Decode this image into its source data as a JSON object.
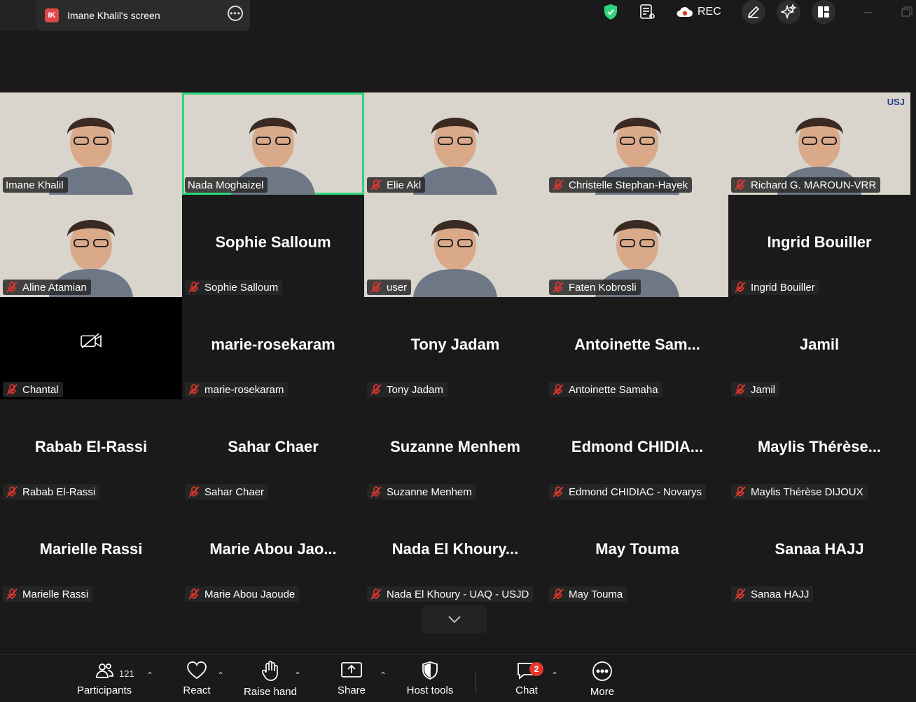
{
  "window": {
    "screen_tab_badge": "IK",
    "screen_tab_title": "Imane Khalil's screen",
    "rec_label": "REC"
  },
  "tiles": [
    {
      "name": "Imane Khalil",
      "video": true,
      "muted": false
    },
    {
      "name": "Nada Moghaizel",
      "video": true,
      "muted": false,
      "active_speaker": true
    },
    {
      "name": "Elie Akl",
      "video": true,
      "muted": true
    },
    {
      "name": "Christelle Stephan-Hayek",
      "video": true,
      "muted": true
    },
    {
      "name": "Richard G. MAROUN-VRR",
      "video": true,
      "muted": true,
      "logo_text": "USJ"
    },
    {
      "name": "Aline Atamian",
      "video": true,
      "muted": true
    },
    {
      "name": "Sophie Salloum",
      "display": "Sophie Salloum",
      "video": false,
      "muted": true
    },
    {
      "name": "user",
      "video": true,
      "muted": true
    },
    {
      "name": "Faten Kobrosli",
      "video": true,
      "muted": true
    },
    {
      "name": "Ingrid Bouiller",
      "display": "Ingrid Bouiller",
      "video": false,
      "muted": true
    },
    {
      "name": "Chantal",
      "video": false,
      "camera_off_icon": true,
      "muted": true
    },
    {
      "name": "marie-rosekaram",
      "display": "marie-rosekaram",
      "video": false,
      "muted": true
    },
    {
      "name": "Tony Jadam",
      "display": "Tony Jadam",
      "video": false,
      "muted": true
    },
    {
      "name": "Antoinette Samaha",
      "display": "Antoinette  Sam...",
      "video": false,
      "muted": true
    },
    {
      "name": "Jamil",
      "display": "Jamil",
      "video": false,
      "muted": true
    },
    {
      "name": "Rabab El-Rassi",
      "display": "Rabab El-Rassi",
      "video": false,
      "muted": true
    },
    {
      "name": "Sahar Chaer",
      "display": "Sahar Chaer",
      "video": false,
      "muted": true
    },
    {
      "name": "Suzanne Menhem",
      "display": "Suzanne Menhem",
      "video": false,
      "muted": true
    },
    {
      "name": "Edmond CHIDIAC - Novarys",
      "display": "Edmond  CHIDIA...",
      "video": false,
      "muted": true
    },
    {
      "name": "Maylis Thérèse DIJOUX",
      "display": "Maylis  Thérèse...",
      "video": false,
      "muted": true
    },
    {
      "name": "Marielle Rassi",
      "display": "Marielle Rassi",
      "video": false,
      "muted": true
    },
    {
      "name": "Marie Abou Jaoude",
      "display": "Marie  Abou  Jao...",
      "video": false,
      "muted": true
    },
    {
      "name": "Nada El Khoury - UAQ - USJD",
      "display": "Nada  El  Khoury...",
      "video": false,
      "muted": true
    },
    {
      "name": "May Touma",
      "display": "May Touma",
      "video": false,
      "muted": true
    },
    {
      "name": "Sanaa HAJJ",
      "display": "Sanaa HAJJ",
      "video": false,
      "muted": true
    }
  ],
  "toolbar": {
    "participants_label": "Participants",
    "participants_count": "121",
    "react_label": "React",
    "raise_hand_label": "Raise hand",
    "share_label": "Share",
    "host_tools_label": "Host tools",
    "chat_label": "Chat",
    "chat_badge": "2",
    "more_label": "More"
  },
  "colors": {
    "active_speaker_border": "#2bd57a",
    "mute_red": "#e5372f",
    "shield_green": "#2bd57a",
    "badge_red": "#e5372f"
  }
}
